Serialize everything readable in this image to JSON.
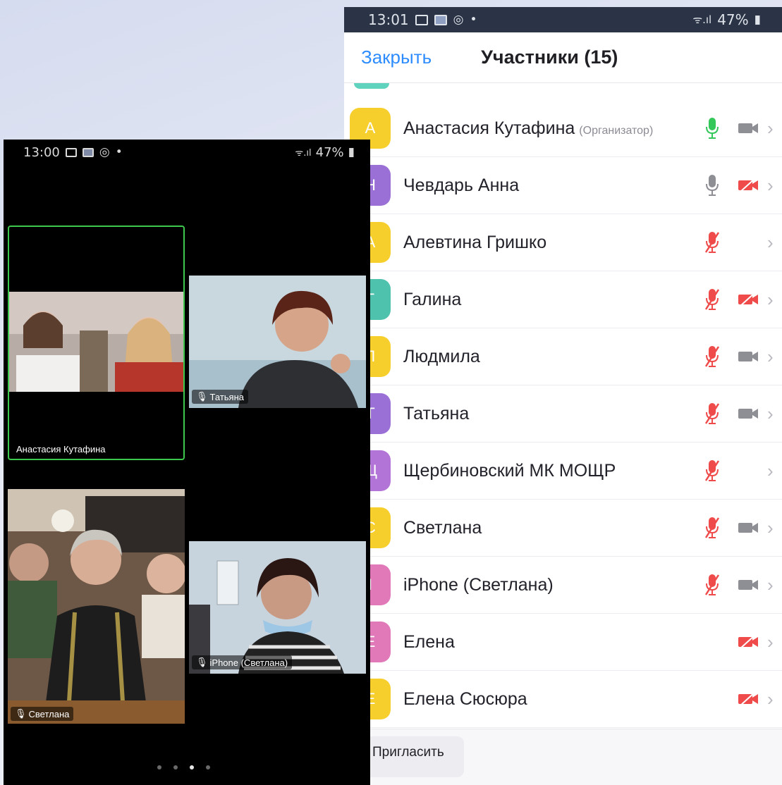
{
  "right_phone": {
    "status_bar": {
      "time": "13:01",
      "signal_text": "ᯤ.ıl",
      "battery": "47%"
    },
    "header": {
      "close_label": "Закрыть",
      "title": "Участники (15)"
    },
    "participants": [
      {
        "initial": "А",
        "name": "Анастасия Кутафина",
        "role": "(Организатор)",
        "avatar_color": "#f7cf2c",
        "mic": "on-active",
        "cam": "on"
      },
      {
        "initial": "Н",
        "name": "Чевдарь Анна",
        "role": "",
        "avatar_color": "#9a6fd6",
        "mic": "on",
        "cam": "off"
      },
      {
        "initial": "А",
        "name": "Алевтина Гришко",
        "role": "",
        "avatar_color": "#f7cf2c",
        "mic": "off",
        "cam": "none"
      },
      {
        "initial": "Г",
        "name": "Галина",
        "role": "",
        "avatar_color": "#4fc2ae",
        "mic": "off",
        "cam": "off"
      },
      {
        "initial": "Л",
        "name": "Людмила",
        "role": "",
        "avatar_color": "#f7cf2c",
        "mic": "off",
        "cam": "on"
      },
      {
        "initial": "Т",
        "name": "Татьяна",
        "role": "",
        "avatar_color": "#9a6fd6",
        "mic": "off",
        "cam": "on"
      },
      {
        "initial": "Щ",
        "name": "Щербиновский МК МОЩР",
        "role": "",
        "avatar_color": "#b374d8",
        "mic": "off",
        "cam": "none"
      },
      {
        "initial": "С",
        "name": "Светлана",
        "role": "",
        "avatar_color": "#f7cf2c",
        "mic": "off",
        "cam": "on"
      },
      {
        "initial": "I",
        "name": "iPhone (Светлана)",
        "role": "",
        "avatar_color": "#e178b8",
        "mic": "off",
        "cam": "on"
      },
      {
        "initial": "Е",
        "name": "Елена",
        "role": "",
        "avatar_color": "#e178b8",
        "mic": "none",
        "cam": "off"
      },
      {
        "initial": "Е",
        "name": "Елена Сюсюра",
        "role": "",
        "avatar_color": "#f7cf2c",
        "mic": "none",
        "cam": "off"
      }
    ],
    "footer": {
      "invite_label": "Пригласить"
    }
  },
  "left_phone": {
    "status_bar": {
      "time": "13:00",
      "signal_text": "ᯤ.ıl",
      "battery": "47%"
    },
    "tiles": {
      "anastasia": {
        "label": "Анастасия Кутафина"
      },
      "tatyana": {
        "label": "Татьяна"
      },
      "svetlana": {
        "label": "Светлана"
      },
      "iphone": {
        "label": "iPhone (Светлана)"
      }
    },
    "page_indicator": {
      "count": 4,
      "active": 3
    }
  },
  "colors": {
    "accent": "#2d8cff",
    "muted_red": "#ef4b4b",
    "mic_active_green": "#34c759",
    "active_speaker_border": "#3ec74d"
  }
}
